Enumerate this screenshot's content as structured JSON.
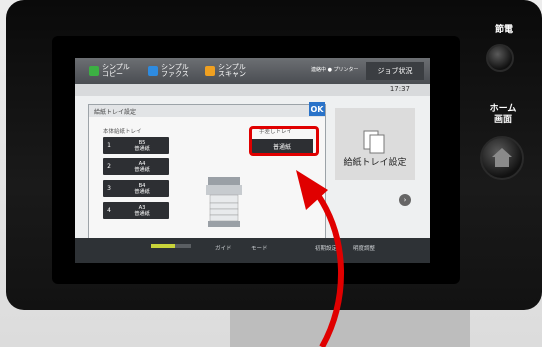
{
  "topbar": {
    "buttons": [
      {
        "label": "シンプル\nコピー",
        "icon": "copy-icon",
        "color": "#3cb043"
      },
      {
        "label": "シンプル\nファクス",
        "icon": "fax-icon",
        "color": "#2e8be0"
      },
      {
        "label": "シンプル\nスキャン",
        "icon": "scan-icon",
        "color": "#f0a020"
      }
    ],
    "status": "連絡中 ● プリンター",
    "job_button": "ジョブ状況"
  },
  "time": "17:37",
  "dialog": {
    "title": "給紙トレイ設定",
    "ok": "OK",
    "main_tray_label": "本体給紙トレイ",
    "bypass_label": "手差しトレイ",
    "bypass_value": "普通紙",
    "trays": [
      {
        "num": "1",
        "text": "B5\n普通紙"
      },
      {
        "num": "2",
        "text": "A4\n普通紙"
      },
      {
        "num": "3",
        "text": "B4\n普通紙"
      },
      {
        "num": "4",
        "text": "A3\n普通紙"
      }
    ]
  },
  "side_tile": {
    "label": "給紙トレイ設定"
  },
  "bottombar": {
    "guide": "ガイド",
    "mode": "モード",
    "settings": "初期設定",
    "brightness": "明度調整"
  },
  "hardware": {
    "power": "節電",
    "home": "ホーム\n画面"
  },
  "colors": {
    "accent": "#2a73c9",
    "highlight": "#e00000"
  }
}
